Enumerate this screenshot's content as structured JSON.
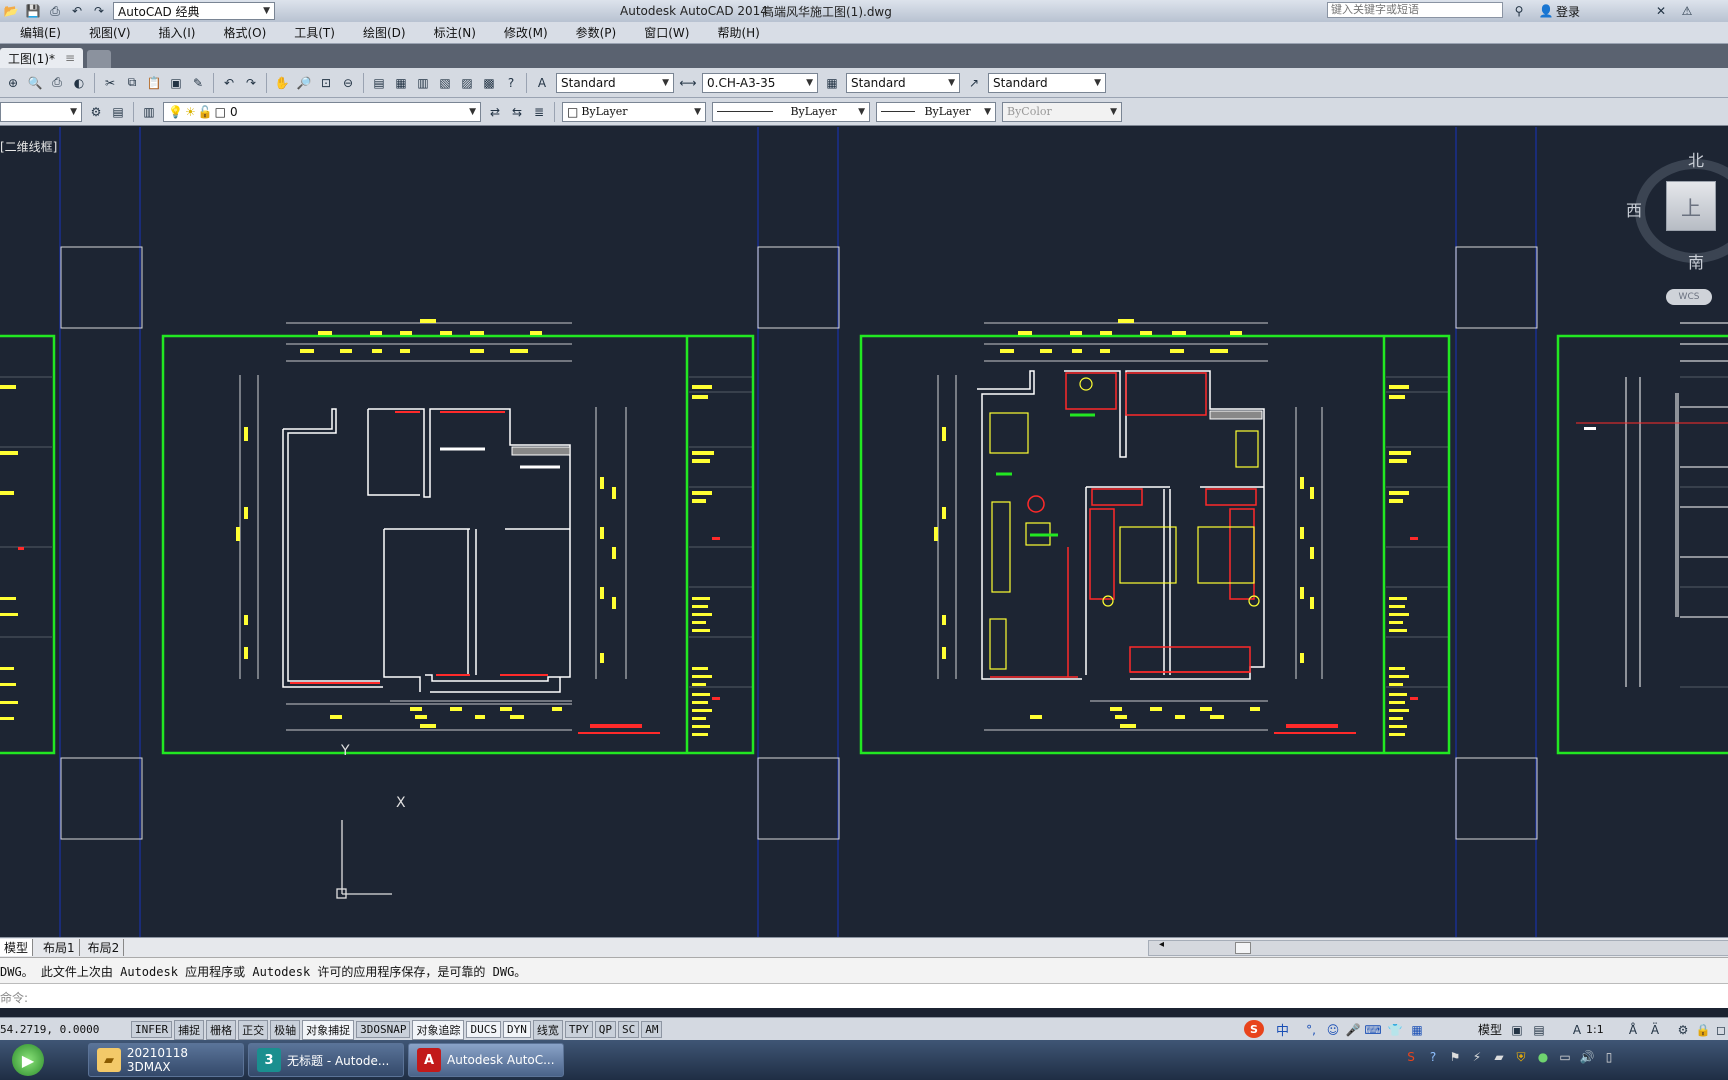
{
  "titlebar": {
    "workspace": "AutoCAD 经典",
    "app_title": "Autodesk AutoCAD 2014",
    "file_name": "高端风华施工图(1).dwg",
    "search_placeholder": "键入关键字或短语",
    "login_label": "登录"
  },
  "menubar": {
    "items": [
      "编辑(E)",
      "视图(V)",
      "插入(I)",
      "格式(O)",
      "工具(T)",
      "绘图(D)",
      "标注(N)",
      "修改(M)",
      "参数(P)",
      "窗口(W)",
      "帮助(H)"
    ]
  },
  "doctabs": {
    "active": "工图(1)*"
  },
  "toolbar_styles": {
    "text_style": "Standard",
    "dim_style": "0.CH-A3-35",
    "table_style": "Standard",
    "multileader_style": "Standard"
  },
  "toolbar_layers": {
    "layer_name": "0",
    "color": "ByLayer",
    "linetype": "ByLayer",
    "lineweight": "ByLayer",
    "plotstyle": "ByColor"
  },
  "viewport": {
    "label": "[二维线框]"
  },
  "viewcube": {
    "north": "北",
    "west": "西",
    "south": "南",
    "top": "上",
    "wcs": "WCS"
  },
  "ucs": {
    "x_label": "X",
    "y_label": "Y"
  },
  "layout_tabs": [
    "模型",
    "布局1",
    "布局2"
  ],
  "command": {
    "history": "DWG。  此文件上次由 Autodesk 应用程序或 Autodesk 许可的应用程序保存，是可靠的 DWG。",
    "prompt": "命令:"
  },
  "status": {
    "coords": "54.2719, 0.0000",
    "toggles": [
      {
        "label": "INFER",
        "on": false
      },
      {
        "label": "捕捉",
        "on": false
      },
      {
        "label": "栅格",
        "on": false
      },
      {
        "label": "正交",
        "on": false
      },
      {
        "label": "极轴",
        "on": false
      },
      {
        "label": "对象捕捉",
        "on": true
      },
      {
        "label": "3DOSNAP",
        "on": false
      },
      {
        "label": "对象追踪",
        "on": true
      },
      {
        "label": "DUCS",
        "on": true
      },
      {
        "label": "DYN",
        "on": true
      },
      {
        "label": "线宽",
        "on": false
      },
      {
        "label": "TPY",
        "on": false
      },
      {
        "label": "QP",
        "on": false
      },
      {
        "label": "SC",
        "on": false
      },
      {
        "label": "AM",
        "on": false
      }
    ],
    "ime": "中",
    "model_label": "模型",
    "scale": "1:1"
  },
  "taskbar": {
    "items": [
      {
        "label": "20210118 3DMAX",
        "icon": "folder-icon"
      },
      {
        "label": "无标题 - Autode...",
        "icon": "3dsmax-icon"
      },
      {
        "label": "Autodesk AutoC...",
        "icon": "autocad-icon"
      }
    ]
  },
  "colors": {
    "canvas": "#1d2533",
    "frame": "#22e822",
    "wall": "#ffffff",
    "dim": "#ffff33",
    "accent": "#ff2a2a"
  }
}
